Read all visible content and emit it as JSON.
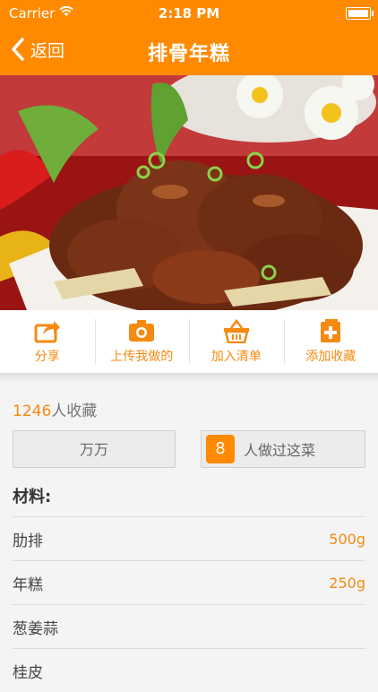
{
  "status_bar": {
    "carrier": "Carrier",
    "time": "2:18 PM"
  },
  "nav": {
    "back_label": "返回",
    "title": "排骨年糕"
  },
  "actions": [
    {
      "label": "分享",
      "icon": "share-icon"
    },
    {
      "label": "上传我做的",
      "icon": "camera-icon"
    },
    {
      "label": "加入清单",
      "icon": "basket-icon"
    },
    {
      "label": "添加收藏",
      "icon": "add-favorite-icon"
    }
  ],
  "favorites": {
    "count": "1246",
    "label": "人收藏"
  },
  "user_input": {
    "value": "万万"
  },
  "made": {
    "count": "8",
    "label": "人做过这菜"
  },
  "ingredients": {
    "title": "材料:",
    "items": [
      {
        "name": "肋排",
        "amount": "500g"
      },
      {
        "name": "年糕",
        "amount": "250g"
      },
      {
        "name": "葱姜蒜",
        "amount": ""
      },
      {
        "name": "桂皮",
        "amount": ""
      }
    ]
  },
  "colors": {
    "accent": "#ff8a00",
    "accent_text": "#f58a10",
    "background": "#f4f4f4"
  }
}
